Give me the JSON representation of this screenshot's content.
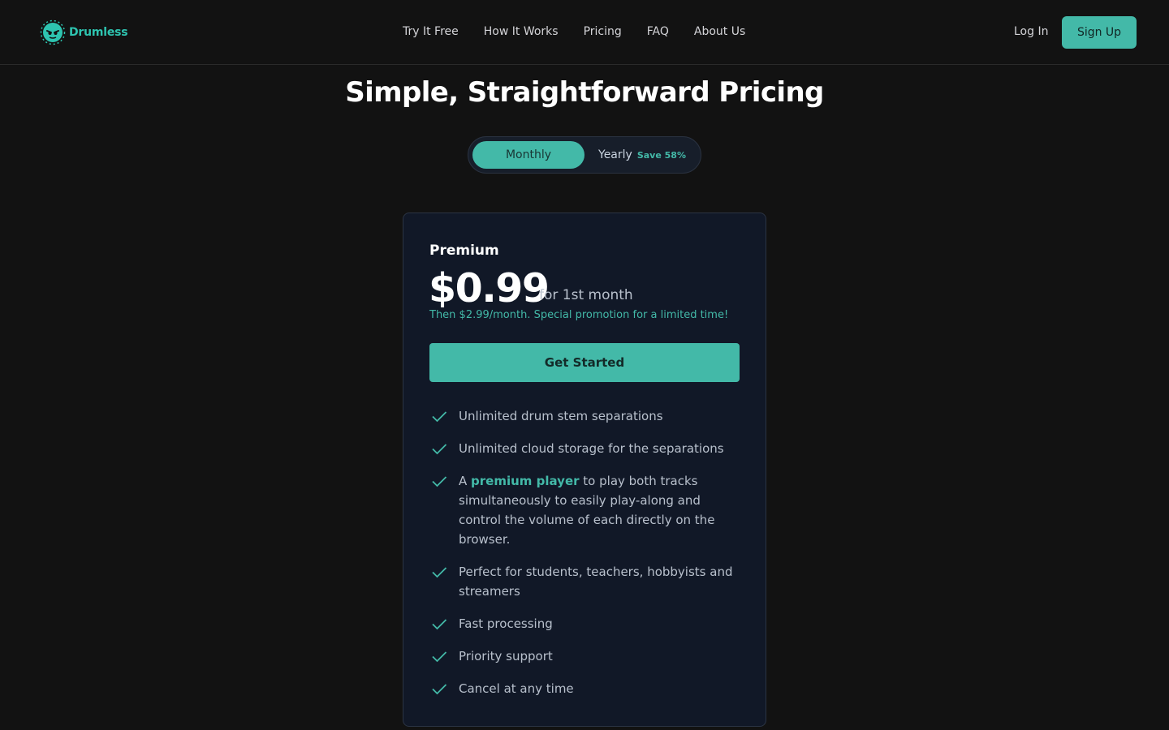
{
  "header": {
    "logo_text": "Drumless",
    "nav": [
      "Try It Free",
      "How It Works",
      "Pricing",
      "FAQ",
      "About Us"
    ],
    "login_label": "Log In",
    "signup_label": "Sign Up"
  },
  "main": {
    "title": "Simple, Straightforward Pricing",
    "toggle": {
      "monthly_label": "Monthly",
      "yearly_label": "Yearly",
      "save_label": "Save 58%",
      "selected": "Monthly"
    },
    "plan": {
      "name": "Premium",
      "price": "$0.99",
      "period": "for 1st month",
      "promo": "Then $2.99/month. Special promotion for a limited time!",
      "cta_label": "Get Started",
      "features": [
        "Unlimited drum stem separations",
        "Unlimited cloud storage for the separations",
        {
          "prefix": "A ",
          "highlight": "premium player",
          "suffix": " to play both tracks simultaneously to easily play-along and control the volume of each directly on the browser."
        },
        "Perfect for students, teachers, hobbyists and streamers",
        "Fast processing",
        "Priority support",
        "Cancel at any time"
      ]
    }
  },
  "colors": {
    "accent": "#43b9a8",
    "background": "#121212",
    "card": "#111827"
  }
}
